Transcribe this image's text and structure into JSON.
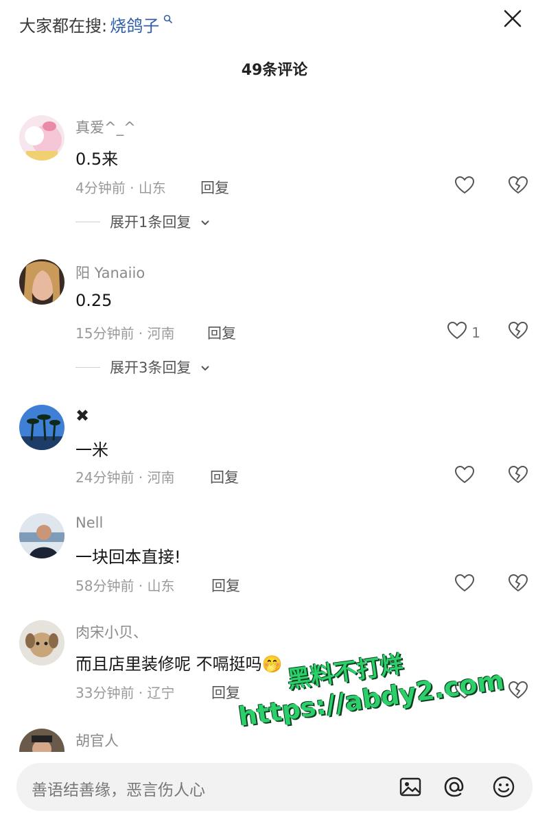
{
  "header": {
    "search_prefix": "大家都在搜:",
    "search_keyword": "烧鸽子",
    "comment_count_title": "49条评论"
  },
  "comments": [
    {
      "username": "真爱^_^",
      "text": "0.5来",
      "time": "4分钟前",
      "location": "山东",
      "reply": "回复",
      "likes": "",
      "expand": "展开1条回复"
    },
    {
      "username": "阳 Yanaiio",
      "text": "0.25",
      "time": "15分钟前",
      "location": "河南",
      "reply": "回复",
      "likes": "1",
      "expand": "展开3条回复"
    },
    {
      "username": "✖",
      "text": "一米",
      "time": "24分钟前",
      "location": "河南",
      "reply": "回复",
      "likes": ""
    },
    {
      "username": "Nell",
      "text": "一块回本直接!",
      "time": "58分钟前",
      "location": "山东",
      "reply": "回复",
      "likes": ""
    },
    {
      "username": "肉宋小贝、",
      "text": "而且店里装修呢 不嗝挺吗",
      "emoji": "🤭",
      "time": "33分钟前",
      "location": "辽宁",
      "reply": "回复",
      "likes": ""
    },
    {
      "username": "胡官人"
    }
  ],
  "watermark": {
    "line1": "黑料不打烊",
    "line2": "https://abdy2.com"
  },
  "input": {
    "placeholder": "善语结善缘，恶言伤人心"
  },
  "colors": {
    "accent_link": "#2f5ea8",
    "watermark": "#2bd06a"
  }
}
